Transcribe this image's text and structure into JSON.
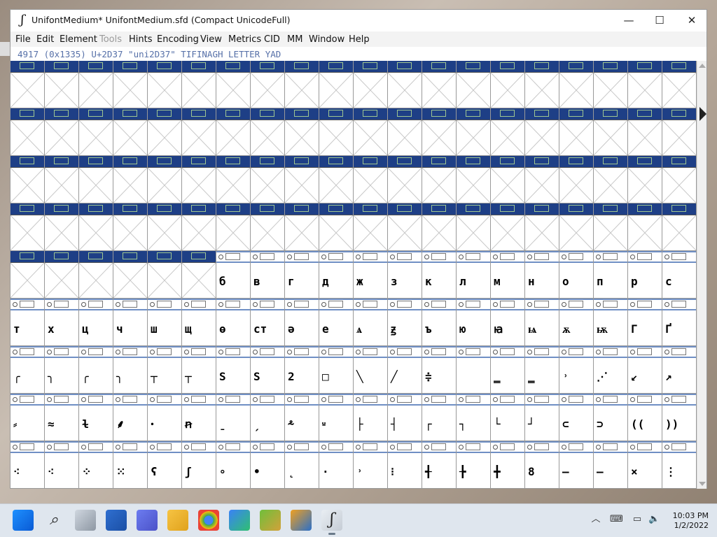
{
  "window": {
    "title": "UnifontMedium*  UnifontMedium.sfd (Compact UnicodeFull)",
    "app_icon": "fontforge-icon",
    "controls": {
      "minimize": "—",
      "maximize": "☐",
      "close": "✕"
    }
  },
  "menu": {
    "items": [
      {
        "label": "File",
        "enabled": true
      },
      {
        "label": "Edit",
        "enabled": true
      },
      {
        "label": "Element",
        "enabled": true
      },
      {
        "label": "Tools",
        "enabled": false
      },
      {
        "label": "Hints",
        "enabled": true
      },
      {
        "label": "Encoding",
        "enabled": true
      },
      {
        "label": "View",
        "enabled": true
      },
      {
        "label": "Metrics",
        "enabled": true
      },
      {
        "label": "CID",
        "enabled": true
      },
      {
        "label": "MM",
        "enabled": true
      },
      {
        "label": "Window",
        "enabled": true
      },
      {
        "label": "Help",
        "enabled": true
      }
    ]
  },
  "info_line": "4917 (0x1335) U+2D37 \"uni2D37\" TIFINAGH LETTER YAD",
  "glyph_grid": {
    "columns": 20,
    "rows": [
      {
        "header": "blue",
        "glyphs": [
          "",
          "",
          "",
          "",
          "",
          "",
          "",
          "",
          "",
          "",
          "",
          "",
          "",
          "",
          "",
          "",
          "",
          "",
          "",
          ""
        ],
        "empty": true
      },
      {
        "header": "blue",
        "glyphs": [
          "",
          "",
          "",
          "",
          "",
          "",
          "",
          "",
          "",
          "",
          "",
          "",
          "",
          "",
          "",
          "",
          "",
          "",
          "",
          ""
        ],
        "empty": true
      },
      {
        "header": "blue",
        "glyphs": [
          "",
          "",
          "",
          "",
          "",
          "",
          "",
          "",
          "",
          "",
          "",
          "",
          "",
          "",
          "",
          "",
          "",
          "",
          "",
          ""
        ],
        "empty": true
      },
      {
        "header": "blue",
        "glyphs": [
          "",
          "",
          "",
          "",
          "",
          "",
          "",
          "",
          "",
          "",
          "",
          "",
          "",
          "",
          "",
          "",
          "",
          "",
          "",
          ""
        ],
        "empty": true
      },
      {
        "header": "mixed",
        "blue_count": 6,
        "glyphs": [
          "",
          "",
          "",
          "",
          "",
          "",
          "б",
          "в",
          "г",
          "д",
          "ж",
          "з",
          "к",
          "л",
          "м",
          "н",
          "о",
          "п",
          "р",
          "с"
        ]
      },
      {
        "header": "light",
        "glyphs": [
          "т",
          "х",
          "ц",
          "ч",
          "ш",
          "щ",
          "ө",
          "ст",
          "ә",
          "е",
          "ѧ",
          "ꙃ",
          "ъ",
          "ю",
          "ꙗ",
          "ѩ",
          "ѫ",
          "ѭ",
          "Г",
          "Ґ"
        ]
      },
      {
        "header": "light",
        "glyphs": [
          "╭",
          "╮",
          "╭",
          "╮",
          "┬",
          "┬",
          "S",
          "S",
          "2",
          "□",
          "╲",
          "╱",
          "≑",
          "",
          "‗",
          "‗",
          "˒",
          "⋰",
          "↙",
          "↗"
        ]
      },
      {
        "header": "light",
        "glyphs": [
          "⸗",
          "≈",
          "ɫ",
          "⸙",
          "ꞏ",
          "ꞥ",
          "ˍ",
          "ˏ",
          "⸛",
          "⸚",
          "├",
          "┤",
          "┌",
          "┐",
          "└",
          "┘",
          "⊂",
          "⊃",
          "((",
          "))"
        ]
      },
      {
        "header": "light",
        "glyphs": [
          "⁖",
          "⁖",
          "⁘",
          "⁙",
          "ʕ",
          "ʃ",
          "∘",
          "•",
          "˛",
          "·",
          "˒",
          "⁝",
          "╉",
          "╊",
          "╋",
          "8",
          "—",
          "—",
          "×",
          "⋮"
        ]
      }
    ]
  },
  "taskbar": {
    "icons": [
      "start-icon",
      "search-icon",
      "task-view-icon",
      "widgets-icon",
      "chat-icon",
      "file-explorer-icon",
      "chrome-icon",
      "store-icon",
      "app-icon-1",
      "app-icon-2",
      "fontforge-icon"
    ],
    "time": "10:03 PM",
    "date": "1/2/2022"
  },
  "colors": {
    "header_blue": "#1e3f86",
    "header_light_border": "#6f8fc4",
    "info_text": "#5670a8",
    "taskbar_bg": "#dfe6ee"
  }
}
